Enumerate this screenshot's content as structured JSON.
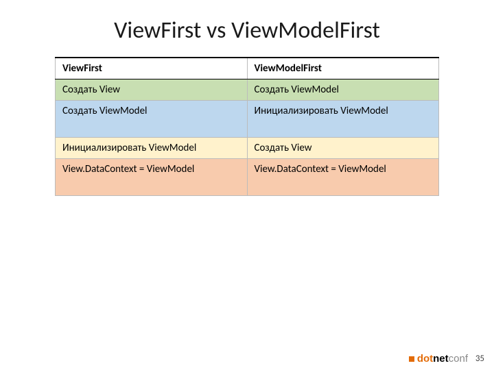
{
  "title": "ViewFirst vs ViewModelFirst",
  "table": {
    "headers": [
      "ViewFirst",
      "ViewModelFirst"
    ],
    "rows": [
      {
        "class": "row-green",
        "cells": [
          "Создать View",
          "Создать ViewModel"
        ]
      },
      {
        "class": "row-blue",
        "cells": [
          "Создать ViewModel",
          "Инициализировать ViewModel"
        ],
        "tall": true
      },
      {
        "class": "row-yellow",
        "cells": [
          "Инициализировать ViewModel",
          "Создать View"
        ]
      },
      {
        "class": "row-orange",
        "cells": [
          "View.DataContext = ViewModel",
          "View.DataContext = ViewModel"
        ],
        "tall": true
      }
    ]
  },
  "footer": {
    "logo": {
      "dot": "dot",
      "net": "net",
      "conf": "conf"
    },
    "page": "35"
  }
}
